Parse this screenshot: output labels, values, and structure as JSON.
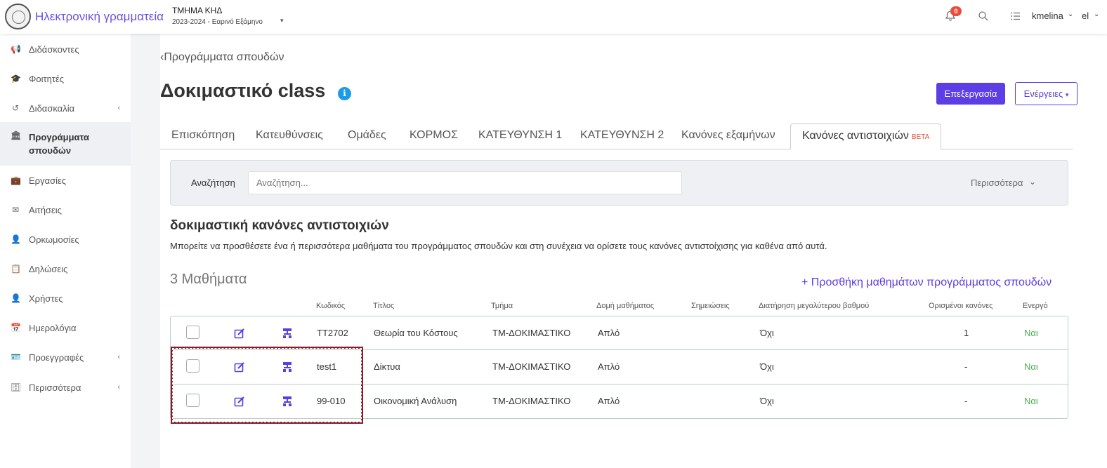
{
  "header": {
    "app_title": "Ηλεκτρονική γραμματεία",
    "department": "ΤΜΗΜΑ ΚΗΔ",
    "period": "2023-2024 - Εαρινό Εξάμηνο",
    "notifications_count": "0",
    "username": "kmelina",
    "language": "el"
  },
  "sidebar": {
    "items": [
      {
        "label": "Διδάσκοντες",
        "icon": "megaphone-icon"
      },
      {
        "label": "Φοιτητές",
        "icon": "graduation-cap-icon"
      },
      {
        "label": "Διδασκαλία",
        "icon": "history-icon",
        "expandable": true
      },
      {
        "label": "Προγράμματα σπουδών",
        "icon": "institution-icon",
        "active": true
      },
      {
        "label": "Εργασίες",
        "icon": "briefcase-icon"
      },
      {
        "label": "Αιτήσεις",
        "icon": "envelope-icon"
      },
      {
        "label": "Ορκωμοσίες",
        "icon": "user-graduate-icon"
      },
      {
        "label": "Δηλώσεις",
        "icon": "clipboard-icon"
      },
      {
        "label": "Χρήστες",
        "icon": "user-icon"
      },
      {
        "label": "Ημερολόγια",
        "icon": "calendar-icon"
      },
      {
        "label": "Προεγγραφές",
        "icon": "id-card-icon",
        "expandable": true
      },
      {
        "label": "Περισσότερα",
        "icon": "archive-icon",
        "expandable": true
      }
    ]
  },
  "page": {
    "back_link": "Προγράμματα σπουδών",
    "title": "Δοκιμαστικό class",
    "edit_button": "Επεξεργασία",
    "actions_button": "Ενέργειες"
  },
  "tabs": [
    {
      "label": "Επισκόπηση"
    },
    {
      "label": "Κατευθύνσεις"
    },
    {
      "label": "Ομάδες"
    },
    {
      "label": "ΚΟΡΜΟΣ"
    },
    {
      "label": "ΚΑΤΕΥΘΥΝΣΗ 1"
    },
    {
      "label": "ΚΑΤΕΥΘΥΝΣΗ 2"
    },
    {
      "label": "Κανόνες εξαμήνων"
    },
    {
      "label": "Κανόνες αντιστοιχιών",
      "badge": "BETA",
      "active": true
    }
  ],
  "search": {
    "label": "Αναζήτηση",
    "placeholder": "Αναζήτηση...",
    "more": "Περισσότερα"
  },
  "section": {
    "title": "δοκιμαστική κανόνες αντιστοιχιών",
    "description": "Μπορείτε να προσθέσετε ένα ή περισσότερα μαθήματα του προγράμματος σπουδών και στη συνέχεια να ορίσετε τους κανόνες αντιστοίχισης για καθένα από αυτά.",
    "count_title": "3 Μαθήματα",
    "add_link": "+ Προσθήκη μαθημάτων προγράμματος σπουδών"
  },
  "table": {
    "columns": [
      "Κωδικός",
      "Τίτλος",
      "Τμήμα",
      "Δομή μαθήματος",
      "Σημειώσεις",
      "Διατήρηση μεγαλύτερου βαθμού",
      "Ορισμένοι κανόνες",
      "Ενεργό"
    ],
    "rows": [
      {
        "code": "TT2702",
        "title": "Θεωρία του Κόστους",
        "department": "ΤΜ-ΔΟΚΙΜΑΣΤΙΚΟ",
        "structure": "Απλό",
        "notes": "",
        "keep_highest": "Όχι",
        "rules": "1",
        "active": "Ναι"
      },
      {
        "code": "test1",
        "title": "Δίκτυα",
        "department": "ΤΜ-ΔΟΚΙΜΑΣΤΙΚΟ",
        "structure": "Απλό",
        "notes": "",
        "keep_highest": "Όχι",
        "rules": "-",
        "active": "Ναι"
      },
      {
        "code": "99-010",
        "title": "Οικονομική Ανάλυση",
        "department": "ΤΜ-ΔΟΚΙΜΑΣΤΙΚΟ",
        "structure": "Απλό",
        "notes": "",
        "keep_highest": "Όχι",
        "rules": "-",
        "active": "Ναι"
      }
    ]
  },
  "colors": {
    "accent": "#5c3de6",
    "info": "#1e9be8",
    "badge": "#e74c3c",
    "active_text": "#4caf50",
    "highlight_border": "#8b1a2b"
  }
}
